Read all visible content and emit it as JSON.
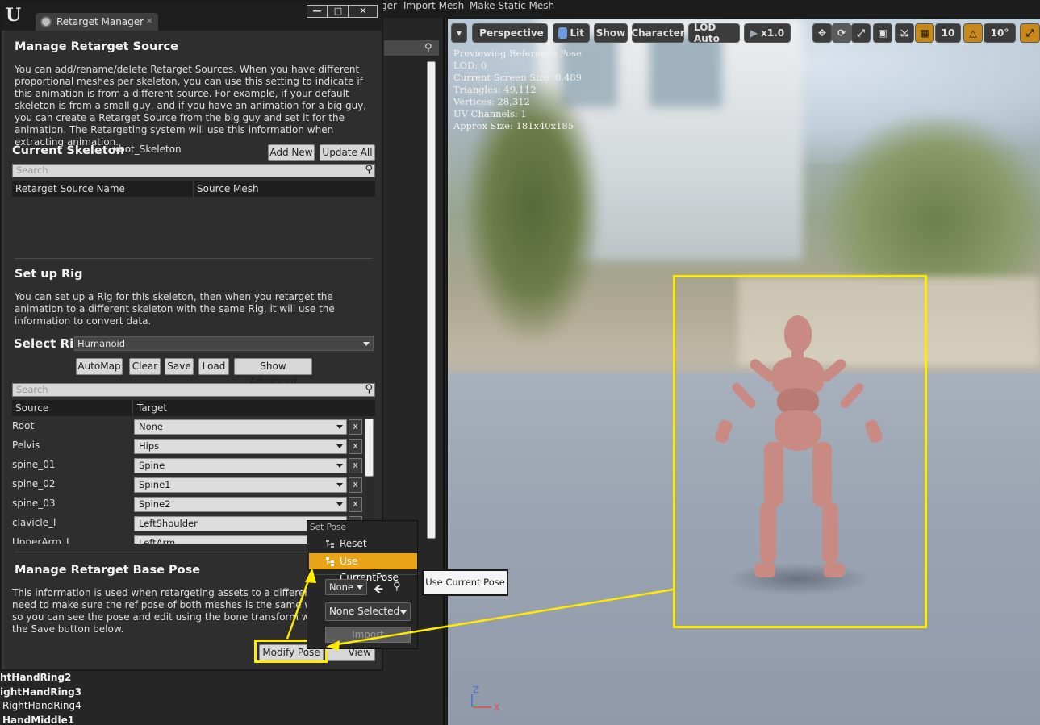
{
  "top_menu": {
    "item1": "ger",
    "item2": "Import Mesh",
    "item3": "Make Static Mesh"
  },
  "bone_list": [
    "htHandRing2",
    "ightHandRing3",
    "RightHandRing4",
    "HandMiddle1"
  ],
  "window": {
    "tab_title": "Retarget Manager",
    "tab_close": "×",
    "minimize": "—",
    "maximize": "□",
    "close": "✕"
  },
  "retarget_source": {
    "title": "Manage Retarget Source",
    "description": "You can add/rename/delete Retarget Sources. When you have different proportional meshes per skeleton, you can use this setting to indicate if this animation is from a different source. For example, if your default skeleton is from a small guy, and if you have an animation for a big guy, you can create a Retarget Source from the big guy and set it for the animation. The Retargeting system will use this information when extracting animation.",
    "current_skeleton_label": "Current Skeleton",
    "current_skeleton_value": "xbot_Skeleton",
    "add_new": "Add New",
    "update_all": "Update All",
    "search_placeholder": "Search",
    "columns": [
      "Retarget Source Name",
      "Source Mesh"
    ]
  },
  "rig": {
    "title": "Set up Rig",
    "description": "You can set up a Rig for this skeleton, then when you retarget the animation to a different skeleton with the same Rig, it will use the information to convert data.",
    "select_rig_label": "Select Rig",
    "select_rig_value": "Humanoid",
    "buttons": [
      "AutoMap",
      "Clear",
      "Save",
      "Load",
      "Show Advanced"
    ],
    "search_placeholder": "Search",
    "columns": [
      "Source",
      "Target"
    ],
    "rows": [
      {
        "source": "Root",
        "target": "None"
      },
      {
        "source": "Pelvis",
        "target": "Hips"
      },
      {
        "source": "spine_01",
        "target": "Spine"
      },
      {
        "source": "spine_02",
        "target": "Spine1"
      },
      {
        "source": "spine_03",
        "target": "Spine2"
      },
      {
        "source": "clavicle_l",
        "target": "LeftShoulder"
      },
      {
        "source": "UpperArm_L",
        "target": "LeftArm"
      }
    ],
    "remove_label": "x"
  },
  "base_pose": {
    "title": "Manage Retarget Base Pose",
    "line1": "This information is used when retargeting assets to a different s",
    "line2": "need to make sure the ref pose of both meshes is the same whe",
    "line3": "so you can see the pose and edit using the bone transform widge",
    "line4": "the Save button below.",
    "modify_pose": "Modify Pose",
    "view_pose": "View Pose"
  },
  "popup": {
    "header": "Set Pose",
    "reset": "Reset",
    "use_current_pose": "Use CurrentPose",
    "none_combo": "None",
    "none_selected": "None Selected",
    "import": "Import"
  },
  "tooltip": "Use Current Pose",
  "viewport": {
    "perspective": "Perspective",
    "lit": "Lit",
    "show": "Show",
    "character": "Character",
    "lod": "LOD Auto",
    "speed": "x1.0",
    "grid_value": "10",
    "angle_value": "10°",
    "info": [
      "Previewing Reference Pose",
      "LOD: 0",
      "Current Screen Size: 0.489",
      "Triangles: 49,112",
      "Vertices: 28,312",
      "UV Channels: 1",
      "Approx Size: 181x40x185"
    ],
    "axis_z": "Z",
    "axis_x": "X"
  },
  "colors": {
    "highlight_yellow": "#ffea00",
    "menu_active": "#e8a318",
    "figure_pink": "#c98a84"
  }
}
